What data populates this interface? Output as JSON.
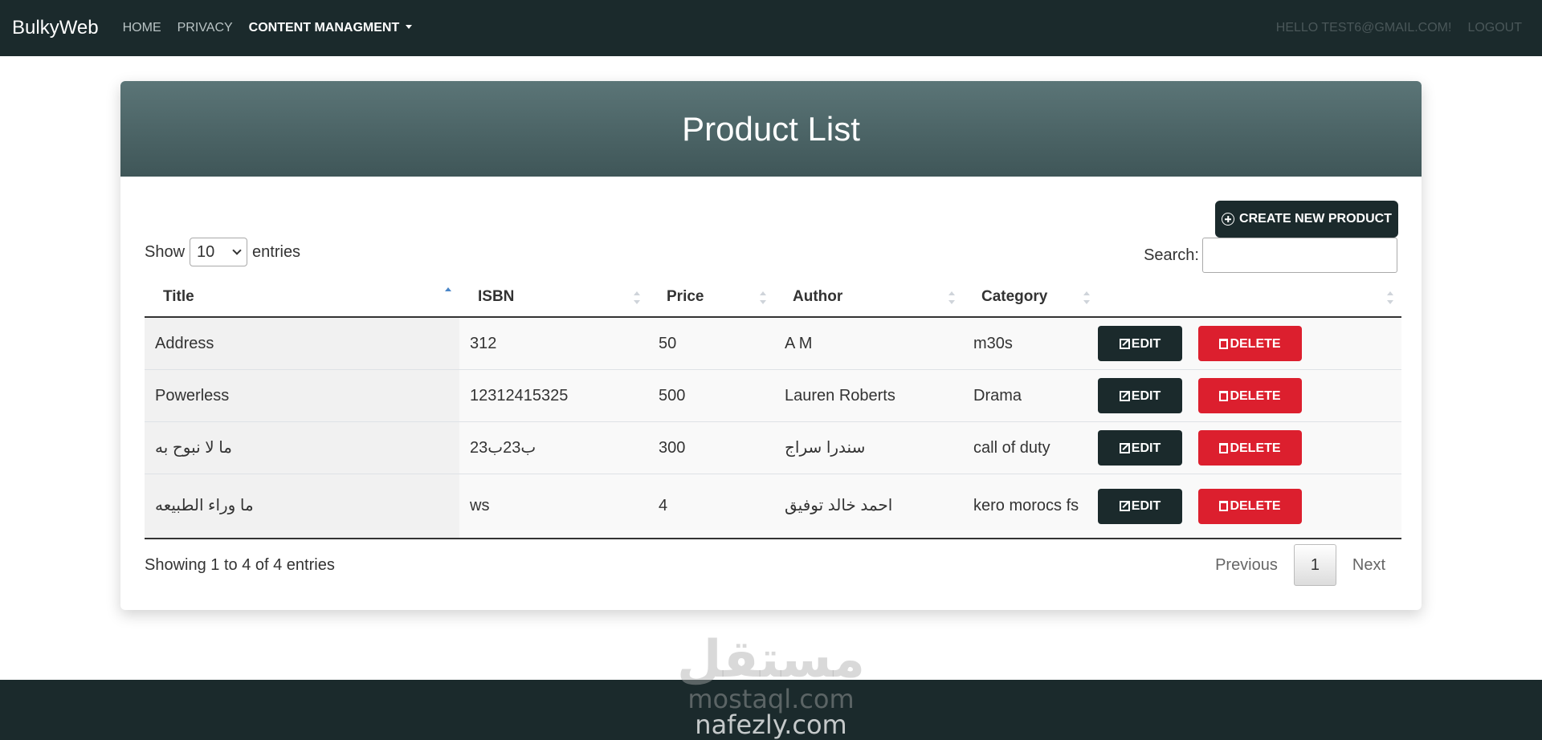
{
  "navbar": {
    "brand": "BulkyWeb",
    "links": [
      "HOME",
      "PRIVACY",
      "CONTENT MANAGMENT"
    ],
    "greeting": "HELLO TEST6@GMAIL.COM!",
    "logout": "LOGOUT"
  },
  "card": {
    "title": "Product List",
    "create_label": "CREATE NEW PRODUCT"
  },
  "table_controls": {
    "show_label": "Show",
    "entries_value": "10",
    "entries_label": "entries",
    "search_label": "Search:",
    "search_value": ""
  },
  "table": {
    "headers": [
      "Title",
      "ISBN",
      "Price",
      "Author",
      "Category",
      ""
    ],
    "rows": [
      {
        "title": "Address",
        "isbn": "312",
        "price": "50",
        "author": "A M",
        "category": "m30s"
      },
      {
        "title": "Powerless",
        "isbn": "12312415325",
        "price": "500",
        "author": "Lauren Roberts",
        "category": "Drama"
      },
      {
        "title": "ما لا نبوح به",
        "isbn": "ب23ب23",
        "price": "300",
        "author": "سندرا سراج",
        "category": "call of duty"
      },
      {
        "title": "ما وراء الطبيعه",
        "isbn": "ws",
        "price": "4",
        "author": "احمد خالد توفيق",
        "category": "kero morocs fs"
      }
    ],
    "edit_label": "EDIT",
    "delete_label": "DELETE"
  },
  "footer_info": {
    "showing": "Showing 1 to 4 of 4 entries",
    "previous": "Previous",
    "page": "1",
    "next": "Next"
  },
  "watermark": {
    "line1": "مستقل",
    "line2": "mostaql.com",
    "line3": "nafezly.com"
  },
  "colors": {
    "navbar": "#1b2a2c",
    "header_gradient_top": "#5b7577",
    "delete": "#dc1f2e"
  }
}
